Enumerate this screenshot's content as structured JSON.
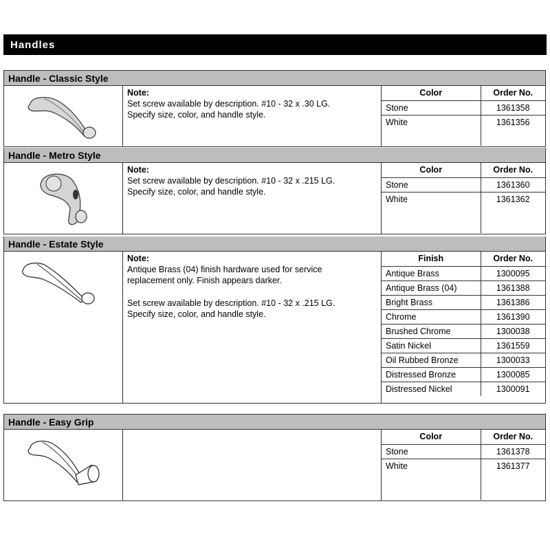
{
  "page_title": "Handles",
  "sections": [
    {
      "title": "Handle - Classic Style",
      "image": "classic-handle-icon",
      "note_label": "Note:",
      "note_paragraphs": [
        [
          "Set screw available by description. #10 - 32 x .30 LG.",
          "Specify size, color, and handle style."
        ]
      ],
      "columns": [
        "Color",
        "Order No."
      ],
      "rows": [
        {
          "option": "Stone",
          "order_no": "1361358"
        },
        {
          "option": "White",
          "order_no": "1361356"
        }
      ]
    },
    {
      "title": "Handle - Metro Style",
      "image": "metro-handle-icon",
      "note_label": "Note:",
      "note_paragraphs": [
        [
          "Set screw available by description. #10 - 32 x .215 LG.",
          "Specify size, color, and handle style."
        ]
      ],
      "columns": [
        "Color",
        "Order No."
      ],
      "rows": [
        {
          "option": "Stone",
          "order_no": "1361360"
        },
        {
          "option": "White",
          "order_no": "1361362"
        }
      ]
    },
    {
      "title": "Handle - Estate Style",
      "image": "estate-handle-icon",
      "note_label": "Note:",
      "note_paragraphs": [
        [
          "Antique Brass (04) finish hardware used for service",
          "replacement only. Finish appears darker."
        ],
        [
          "Set screw available by description. #10 - 32 x .215 LG.",
          "Specify size, color, and handle style."
        ]
      ],
      "columns": [
        "Finish",
        "Order No."
      ],
      "rows": [
        {
          "option": "Antique Brass",
          "order_no": "1300095"
        },
        {
          "option": "Antique Brass (04)",
          "order_no": "1361388"
        },
        {
          "option": "Bright Brass",
          "order_no": "1361386"
        },
        {
          "option": "Chrome",
          "order_no": "1361390"
        },
        {
          "option": "Brushed Chrome",
          "order_no": "1300038"
        },
        {
          "option": "Satin Nickel",
          "order_no": "1361559"
        },
        {
          "option": "Oil Rubbed Bronze",
          "order_no": "1300033"
        },
        {
          "option": "Distressed Bronze",
          "order_no": "1300085"
        },
        {
          "option": "Distressed Nickel",
          "order_no": "1300091"
        }
      ]
    },
    {
      "title": "Handle - Easy Grip",
      "image": "easy-grip-handle-icon",
      "note_label": "",
      "note_paragraphs": [],
      "columns": [
        "Color",
        "Order No."
      ],
      "rows": [
        {
          "option": "Stone",
          "order_no": "1361378"
        },
        {
          "option": "White",
          "order_no": "1361377"
        }
      ]
    }
  ]
}
